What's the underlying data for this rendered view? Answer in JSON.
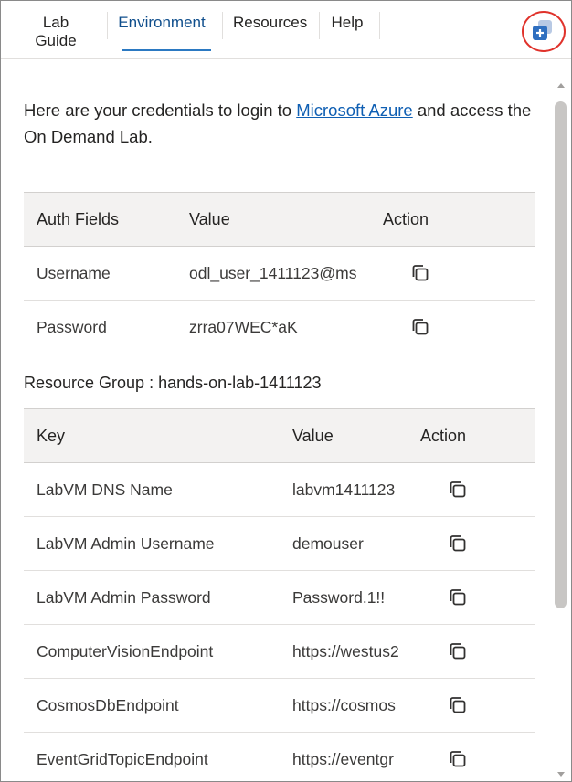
{
  "tabs": [
    {
      "label": "Lab Guide"
    },
    {
      "label": "Environment",
      "active": true
    },
    {
      "label": "Resources"
    },
    {
      "label": "Help"
    }
  ],
  "intro": {
    "before": "Here are your credentials to login to ",
    "link": "Microsoft Azure",
    "after": " and access the On Demand Lab."
  },
  "auth_table": {
    "headers": {
      "field": "Auth Fields",
      "value": "Value",
      "action": "Action"
    },
    "rows": [
      {
        "field": "Username",
        "value": "odl_user_1411123@ms"
      },
      {
        "field": "Password",
        "value": "zrra07WEC*aK"
      }
    ]
  },
  "resource_group": {
    "label": "Resource Group : hands-on-lab-1411123"
  },
  "key_table": {
    "headers": {
      "key": "Key",
      "value": "Value",
      "action": "Action"
    },
    "rows": [
      {
        "key": "LabVM DNS Name",
        "value": "labvm1411123"
      },
      {
        "key": "LabVM Admin Username",
        "value": "demouser"
      },
      {
        "key": "LabVM Admin Password",
        "value": "Password.1!!"
      },
      {
        "key": "ComputerVisionEndpoint",
        "value": "https://westus2"
      },
      {
        "key": "CosmosDbEndpoint",
        "value": "https://cosmos"
      },
      {
        "key": "EventGridTopicEndpoint",
        "value": "https://eventgr"
      }
    ]
  },
  "icons": {
    "copy": "copy-icon",
    "split_window": "split-window-icon"
  },
  "colors": {
    "accent": "#2b79c2",
    "link": "#0f5fb3",
    "highlight_ring": "#e0322b",
    "header_bg": "#f3f2f1"
  }
}
